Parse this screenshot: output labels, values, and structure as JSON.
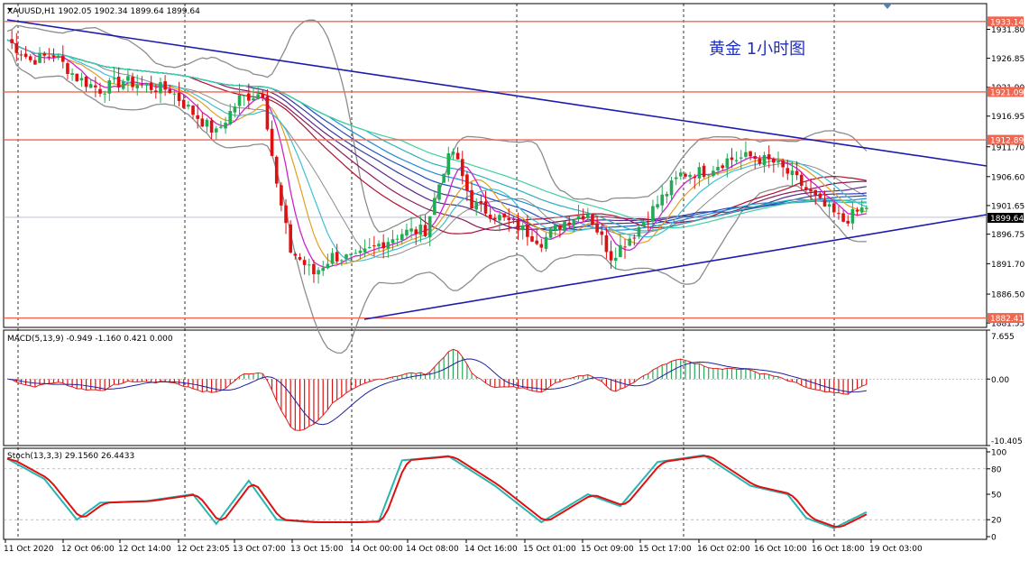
{
  "header": {
    "symbol_line": "XAUUSD,H1  1902.05 1902.34 1899.64 1899.64",
    "annotation": "黄金  1小时图"
  },
  "main_panel": {
    "price_ticks": [
      "1931.80",
      "1926.85",
      "1921.90",
      "1916.95",
      "1911.70",
      "1906.60",
      "1901.65",
      "1896.75",
      "1891.70",
      "1886.50",
      "1881.55"
    ],
    "horizontal_levels": [
      {
        "label": "1933.14",
        "value": 1933.14
      },
      {
        "label": "1921.09",
        "value": 1921.09
      },
      {
        "label": "1912.89",
        "value": 1912.89
      },
      {
        "label": "1882.41",
        "value": 1882.41
      }
    ],
    "current_price": "1899.64",
    "colors": {
      "levels": "#f0664f",
      "trendlines": "#1b1bb0",
      "bollinger": "#8c8c8c",
      "bull": "#22aa55",
      "bear": "#dd1111",
      "price_tag": "#000000"
    }
  },
  "macd_panel": {
    "header": "MACD(5,13,9) -0.949 -1.160 0.421 0.000",
    "ticks": [
      "7.655",
      "0.00",
      "-10.405"
    ]
  },
  "stoch_panel": {
    "header": "Stoch(13,3,3) 29.1560 26.4433",
    "ticks": [
      "100",
      "80",
      "50",
      "20",
      "0"
    ]
  },
  "time_axis": [
    "11 Oct 2020",
    "12 Oct 06:00",
    "12 Oct 14:00",
    "12 Oct 23:05",
    "13 Oct 07:00",
    "13 Oct 15:00",
    "14 Oct 00:00",
    "14 Oct 08:00",
    "14 Oct 16:00",
    "15 Oct 01:00",
    "15 Oct 09:00",
    "15 Oct 17:00",
    "16 Oct 02:00",
    "16 Oct 10:00",
    "16 Oct 18:00",
    "19 Oct 03:00"
  ],
  "chart_data": {
    "type": "candlestick",
    "symbol": "XAUUSD",
    "timeframe": "H1",
    "ohlc_last": {
      "open": 1902.05,
      "high": 1902.34,
      "low": 1899.64,
      "close": 1899.64
    },
    "price_range": [
      1880.8,
      1936.2
    ],
    "close_path": [
      {
        "t": 0,
        "c": 1930.0
      },
      {
        "t": 5,
        "c": 1926.5
      },
      {
        "t": 10,
        "c": 1927.5
      },
      {
        "t": 15,
        "c": 1923.5
      },
      {
        "t": 20,
        "c": 1921.5
      },
      {
        "t": 25,
        "c": 1923.0
      },
      {
        "t": 30,
        "c": 1922.0
      },
      {
        "t": 35,
        "c": 1921.5
      },
      {
        "t": 40,
        "c": 1917.5
      },
      {
        "t": 45,
        "c": 1914.0
      },
      {
        "t": 50,
        "c": 1920.0
      },
      {
        "t": 55,
        "c": 1921.0
      },
      {
        "t": 58,
        "c": 1905.0
      },
      {
        "t": 61,
        "c": 1894.0
      },
      {
        "t": 66,
        "c": 1890.0
      },
      {
        "t": 70,
        "c": 1893.0
      },
      {
        "t": 75,
        "c": 1892.5
      },
      {
        "t": 80,
        "c": 1895.0
      },
      {
        "t": 85,
        "c": 1897.0
      },
      {
        "t": 90,
        "c": 1897.5
      },
      {
        "t": 94,
        "c": 1908.0
      },
      {
        "t": 96,
        "c": 1911.0
      },
      {
        "t": 100,
        "c": 1902.0
      },
      {
        "t": 105,
        "c": 1900.0
      },
      {
        "t": 110,
        "c": 1898.0
      },
      {
        "t": 115,
        "c": 1895.5
      },
      {
        "t": 120,
        "c": 1899.0
      },
      {
        "t": 125,
        "c": 1900.5
      },
      {
        "t": 130,
        "c": 1893.0
      },
      {
        "t": 135,
        "c": 1897.0
      },
      {
        "t": 140,
        "c": 1902.0
      },
      {
        "t": 145,
        "c": 1907.0
      },
      {
        "t": 150,
        "c": 1907.5
      },
      {
        "t": 155,
        "c": 1909.5
      },
      {
        "t": 160,
        "c": 1910.0
      },
      {
        "t": 165,
        "c": 1909.0
      },
      {
        "t": 170,
        "c": 1906.0
      },
      {
        "t": 175,
        "c": 1902.0
      },
      {
        "t": 180,
        "c": 1899.0
      },
      {
        "t": 185,
        "c": 1901.5
      }
    ],
    "stoch_k": [
      {
        "t": 0,
        "v": 92
      },
      {
        "t": 8,
        "v": 68
      },
      {
        "t": 15,
        "v": 20
      },
      {
        "t": 20,
        "v": 40
      },
      {
        "t": 30,
        "v": 42
      },
      {
        "t": 40,
        "v": 50
      },
      {
        "t": 45,
        "v": 15
      },
      {
        "t": 52,
        "v": 66
      },
      {
        "t": 58,
        "v": 20
      },
      {
        "t": 66,
        "v": 17
      },
      {
        "t": 75,
        "v": 17
      },
      {
        "t": 80,
        "v": 18
      },
      {
        "t": 85,
        "v": 90
      },
      {
        "t": 95,
        "v": 95
      },
      {
        "t": 105,
        "v": 60
      },
      {
        "t": 115,
        "v": 17
      },
      {
        "t": 125,
        "v": 50
      },
      {
        "t": 132,
        "v": 36
      },
      {
        "t": 140,
        "v": 88
      },
      {
        "t": 150,
        "v": 96
      },
      {
        "t": 160,
        "v": 60
      },
      {
        "t": 168,
        "v": 50
      },
      {
        "t": 172,
        "v": 22
      },
      {
        "t": 178,
        "v": 10
      },
      {
        "t": 185,
        "v": 29
      }
    ]
  }
}
